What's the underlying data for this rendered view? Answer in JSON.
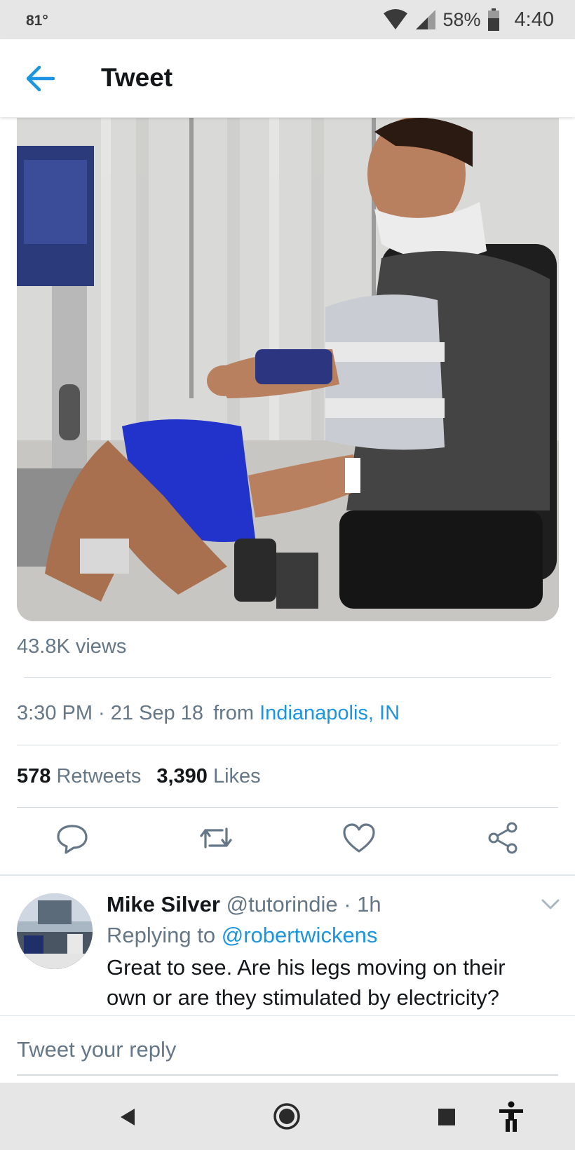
{
  "status": {
    "temperature": "81°",
    "battery": "58%",
    "time": "4:40",
    "icons": [
      "wifi-icon",
      "signal-icon",
      "battery-icon"
    ]
  },
  "header": {
    "title": "Tweet",
    "back_icon": "arrow-left-icon"
  },
  "media": {
    "description_icon": "video-thumbnail"
  },
  "tweet": {
    "views": "43.8K views",
    "time": "3:30 PM · 21 Sep 18",
    "from_label": "from",
    "location": "Indianapolis, IN",
    "retweets_count": "578",
    "retweets_label": "Retweets",
    "likes_count": "3,390",
    "likes_label": "Likes"
  },
  "actions": [
    "reply-icon",
    "retweet-icon",
    "like-icon",
    "share-icon"
  ],
  "reply": {
    "name": "Mike Silver",
    "handle_time": "@tutorindie · 1h",
    "replying_prefix": "Replying to",
    "replying_to": "@robertwickens",
    "text": "Great to see. Are his legs moving on their own or are they stimulated by electricity?"
  },
  "compose": {
    "placeholder": "Tweet your reply"
  },
  "navbar": [
    "back-triangle-icon",
    "home-circle-icon",
    "recents-square-icon",
    "accessibility-icon"
  ],
  "colors": {
    "accent": "#1b95e0",
    "secondary_text": "#657786",
    "primary_text": "#14171a"
  }
}
